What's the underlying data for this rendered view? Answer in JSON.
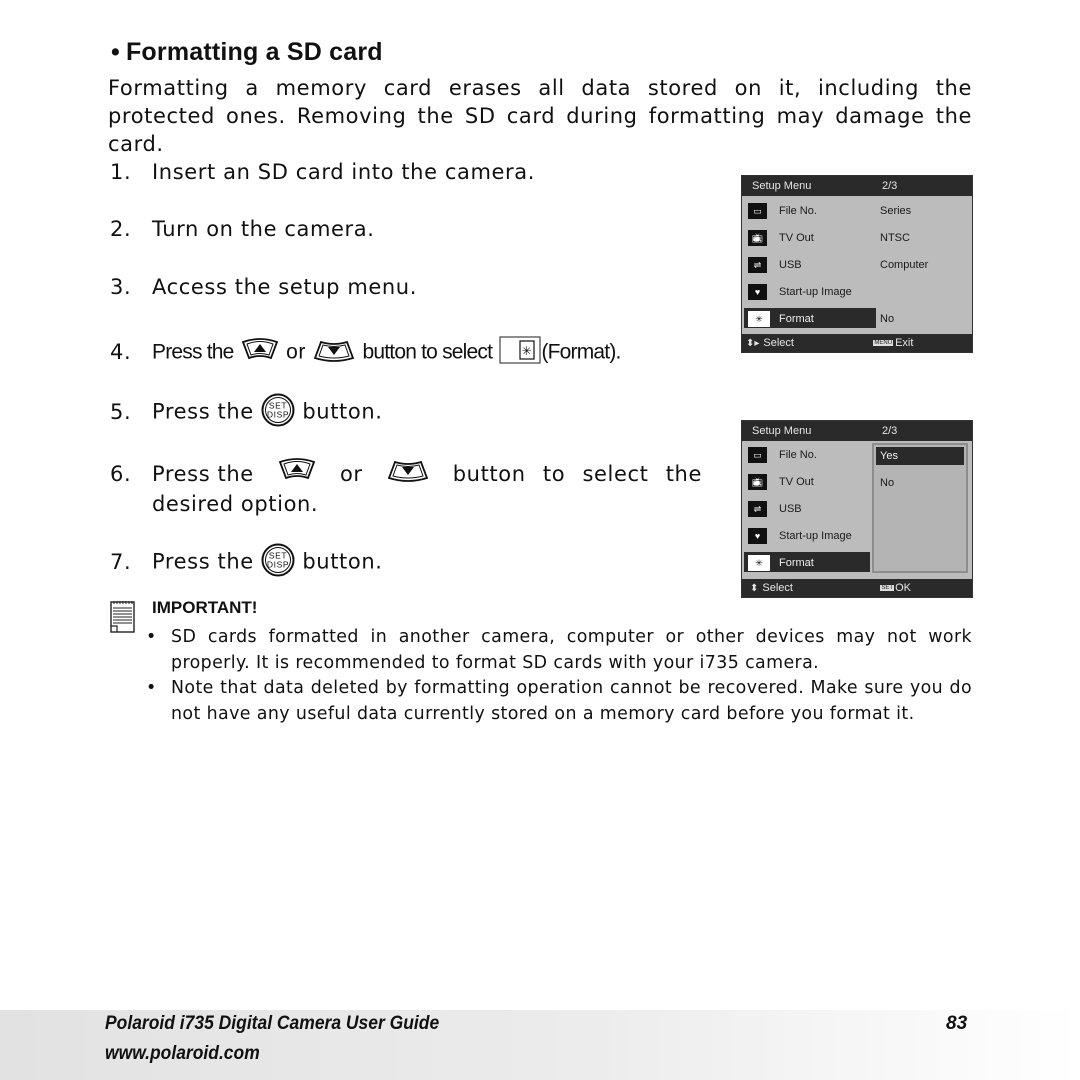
{
  "heading": {
    "bullet": "•",
    "title": "Formatting a SD card"
  },
  "intro": "Formatting a memory card erases all data stored on it, including the protected ones. Removing the SD card during formatting may damage the card.",
  "steps": [
    {
      "num": "1.",
      "text": "Insert an SD card into the camera."
    },
    {
      "num": "2.",
      "text": "Turn on the camera."
    },
    {
      "num": "3.",
      "text": "Access the setup menu."
    },
    {
      "num": "4.",
      "pre": "Press the",
      "mid": "or",
      "post": "button to select",
      "tail": "(Format).",
      "icons": [
        "up-button-icon",
        "down-button-icon",
        "format-icon"
      ]
    },
    {
      "num": "5.",
      "pre": "Press the",
      "post": "button.",
      "icons": [
        "set-disp-button-icon"
      ]
    },
    {
      "num": "6.",
      "pre": "Press the",
      "mid": "or",
      "post": "button to select the",
      "line2": "desired option.",
      "icons": [
        "up-button-icon",
        "down-button-icon"
      ]
    },
    {
      "num": "7.",
      "pre": "Press the",
      "post": "button.",
      "icons": [
        "set-disp-button-icon"
      ]
    }
  ],
  "set_button_label": {
    "top": "SET",
    "bottom": "DISP"
  },
  "lcd1": {
    "title": "Setup Menu",
    "page": "2/3",
    "rows": [
      {
        "icon": "file-number-icon",
        "label": "File No.",
        "value": "Series"
      },
      {
        "icon": "tv-out-icon",
        "label": "TV Out",
        "value": "NTSC"
      },
      {
        "icon": "usb-icon",
        "label": "USB",
        "value": "Computer"
      },
      {
        "icon": "startup-image-icon",
        "label": "Start-up Image",
        "value": ""
      },
      {
        "icon": "format-icon",
        "label": "Format",
        "value": "No",
        "selected": true
      }
    ],
    "footer_left": "Select",
    "footer_key": "MENU",
    "footer_right": "Exit"
  },
  "lcd2": {
    "title": "Setup Menu",
    "page": "2/3",
    "rows": [
      {
        "icon": "file-number-icon",
        "label": "File No."
      },
      {
        "icon": "tv-out-icon",
        "label": "TV Out"
      },
      {
        "icon": "usb-icon",
        "label": "USB"
      },
      {
        "icon": "startup-image-icon",
        "label": "Start-up Image"
      },
      {
        "icon": "format-icon",
        "label": "Format",
        "selected": true
      }
    ],
    "options": [
      {
        "label": "Yes",
        "active": true
      },
      {
        "label": "No",
        "active": false
      }
    ],
    "footer_left": "Select",
    "footer_key": "SET",
    "footer_right": "OK"
  },
  "important": {
    "title": "IMPORTANT!",
    "bullets": [
      "SD cards formatted in another camera, computer or other devices may not work properly. It is recommended to format SD cards with your i735 camera.",
      "Note that data deleted by formatting operation cannot be recovered. Make sure you do not have any useful data currently stored on a memory card before you format it."
    ]
  },
  "footer": {
    "title": "Polaroid i735 Digital Camera User Guide",
    "url": "www.polaroid.com",
    "page": "83"
  },
  "colors": {
    "lcd_bg": "#bcbcbc",
    "lcd_dark": "#2a2a2a",
    "text": "#111111"
  }
}
